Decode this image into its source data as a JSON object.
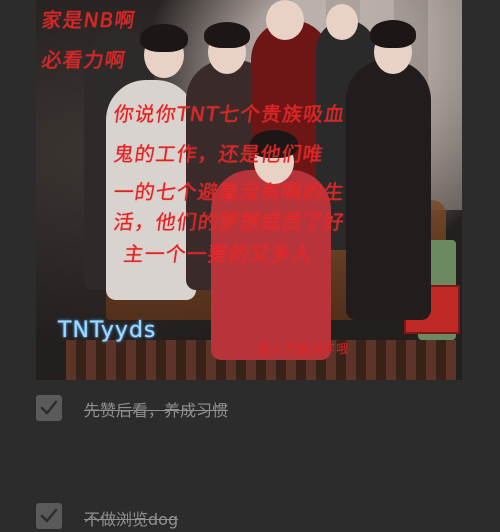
{
  "photo": {
    "handwriting": [
      "家是NB啊",
      "必看力啊",
      "你说你TNT七个贵族吸血",
      "鬼的工作，还是他们唯",
      "一的七个避着没有啊的生",
      "活，他们的梦想成员了好",
      "主一个一要的又多人",
      "TNTyyds",
      "要人完看的字哦"
    ]
  },
  "tasks": [
    {
      "label": "先赞后看，养成习惯",
      "checked": true
    },
    {
      "label": "不做浏览dog",
      "checked": true
    }
  ],
  "colors": {
    "background": "#2c2c2c",
    "handwriting": "#e02222",
    "tag_glow": "#9ed9ff",
    "task_text": "#8f8f8f",
    "checkbox": "#5a5a5a"
  }
}
